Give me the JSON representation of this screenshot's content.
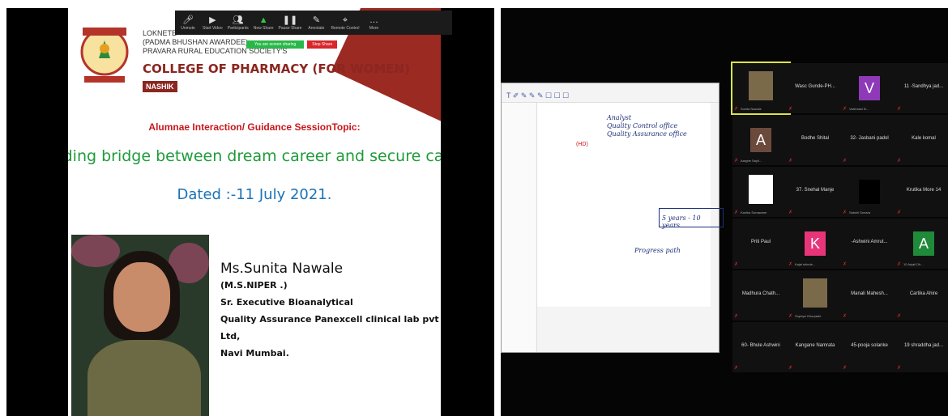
{
  "left": {
    "toolbar": [
      {
        "icon": "mic-icon",
        "label": "Unmute"
      },
      {
        "icon": "video-icon",
        "label": "Start Video"
      },
      {
        "icon": "participants-icon",
        "label": "Participants"
      },
      {
        "icon": "share-icon",
        "label": "New Share"
      },
      {
        "icon": "pause-icon",
        "label": "Pause Share"
      },
      {
        "icon": "annotate-icon",
        "label": "Annotate"
      },
      {
        "icon": "remote-control-icon",
        "label": "Remote Control"
      },
      {
        "icon": "more-icon",
        "label": "More"
      }
    ],
    "share_message": "You are screen sharing",
    "stop_share": "Stop Share",
    "header_lines": [
      "LOKNETE",
      "(PADMA BHUSHAN AWARDEE)",
      "PRAVARA RURAL EDUCATION SOCIETY'S"
    ],
    "college": "COLLEGE OF PHARMACY (FOR WOMEN)",
    "nashik": "NASHIK",
    "topic": "Alumnae Interaction/ Guidance SessionTopic:",
    "headline": "Building bridge between dream career and secure career",
    "dated": "Dated :-11 July 2021.",
    "speaker": {
      "name": "Ms.Sunita Nawale",
      "lines": [
        "(M.S.NIPER .)",
        "Sr. Executive Bioanalytical",
        "Quality Assurance Panexcell clinical lab pvt Ltd,",
        "Navi Mumbai."
      ]
    }
  },
  "right": {
    "ipad_tools": "T ✐ ✎ ✎ ✎ ☐ ☐ ☐",
    "handwriting": [
      "Analyst",
      "Quality Control office",
      "Quality Assurance office",
      "5 years - 10 years",
      "Progress path"
    ],
    "red_mark": "(HD)",
    "tiles": [
      {
        "name": "",
        "sub": "Sunita Nawale",
        "type": "photo",
        "active": true
      },
      {
        "name": "Wasc Gunde-PH...",
        "sub": "",
        "type": "name"
      },
      {
        "name": "V",
        "sub": "Vaishnavi B...",
        "type": "avatar",
        "color": "#8e3ab8"
      },
      {
        "name": "11 -Sandhya jad...",
        "sub": "",
        "type": "name"
      },
      {
        "name": "A",
        "sub": "Aarghe Sayli...",
        "type": "avatar",
        "color": "#6b4a3c"
      },
      {
        "name": "Bodhe Shital",
        "sub": "",
        "type": "name"
      },
      {
        "name": "32- Jasbani padol",
        "sub": "",
        "type": "name"
      },
      {
        "name": "Kale komal",
        "sub": "",
        "type": "name"
      },
      {
        "name": "",
        "sub": "Kanika Sonawane",
        "type": "logo"
      },
      {
        "name": "37. Snehal Manje",
        "sub": "",
        "type": "name"
      },
      {
        "name": "",
        "sub": "Sakshi Sonara",
        "type": "dark"
      },
      {
        "name": "Krutika More 14",
        "sub": "",
        "type": "name"
      },
      {
        "name": "Priti Paul",
        "sub": "",
        "type": "name"
      },
      {
        "name": "K",
        "sub": "Kajal shinde...",
        "type": "avatar",
        "color": "#e8357a"
      },
      {
        "name": "-Ashwini Amrut...",
        "sub": "",
        "type": "name"
      },
      {
        "name": "A",
        "sub": "10 Anjali Dh...",
        "type": "avatar",
        "color": "#1f8a3a"
      },
      {
        "name": "Madhura Chath...",
        "sub": "",
        "type": "name"
      },
      {
        "name": "",
        "sub": "Supriya Ghorpade",
        "type": "photo2"
      },
      {
        "name": "Manali Mahesh...",
        "sub": "",
        "type": "name"
      },
      {
        "name": "Cartika Ahire",
        "sub": "",
        "type": "name"
      },
      {
        "name": "60- Bhule Ashwini",
        "sub": "",
        "type": "name"
      },
      {
        "name": "Kangane Namrata",
        "sub": "",
        "type": "name"
      },
      {
        "name": "45-pooja solanke",
        "sub": "",
        "type": "name"
      },
      {
        "name": "19 shraddha jad...",
        "sub": "",
        "type": "name"
      }
    ]
  }
}
